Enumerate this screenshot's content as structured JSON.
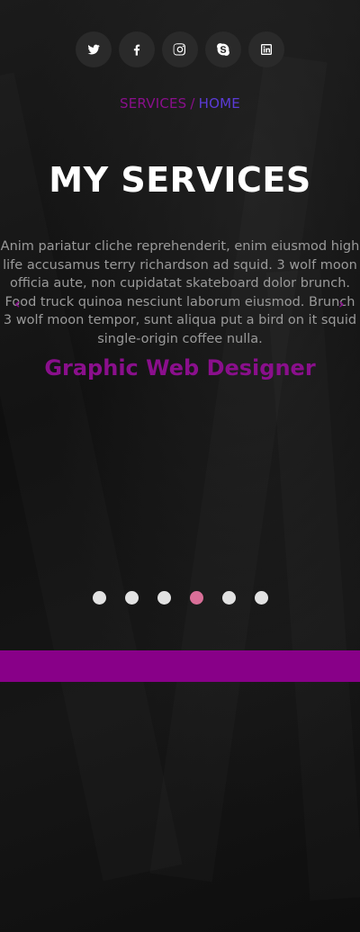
{
  "social": [
    {
      "name": "twitter-icon"
    },
    {
      "name": "facebook-icon"
    },
    {
      "name": "instagram-icon"
    },
    {
      "name": "skype-icon"
    },
    {
      "name": "linkedin-icon"
    }
  ],
  "breadcrumb": {
    "current": "SERVICES",
    "separator": "/",
    "home": "HOME"
  },
  "hero": {
    "title": "MY SERVICES",
    "description": "Anim pariatur cliche reprehenderit, enim eiusmod high\nlife accusamus terry richardson ad squid. 3 wolf moon\nofficia aute, non cupidatat skateboard dolor brunch.\nFood truck quinoa nesciunt laborum eiusmod. Brunch\n3 wolf moon tempor, sunt aliqua put a bird on it squid\nsingle-origin coffee nulla.",
    "role": "Graphic Web Designer",
    "prev_arrow": "‹",
    "next_arrow": "›"
  },
  "carousel": {
    "slide_count": 6,
    "active_index": 3
  },
  "colors": {
    "accent": "#880088",
    "link": "#5b3bd6",
    "active_dot": "#d96f98",
    "dot": "#e2e2e2",
    "background": "#151515"
  }
}
